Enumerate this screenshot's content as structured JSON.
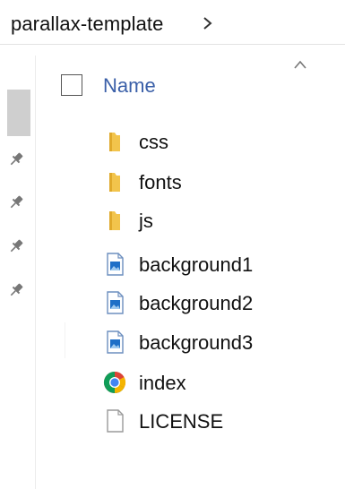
{
  "breadcrumb": {
    "folder": "parallax-template",
    "chevron_icon": "chevron-right-icon"
  },
  "header": {
    "name_label": "Name",
    "sort_icon": "sort-up-icon"
  },
  "files": [
    {
      "name": "css",
      "icon": "folder-icon"
    },
    {
      "name": "fonts",
      "icon": "folder-icon"
    },
    {
      "name": "js",
      "icon": "folder-icon"
    },
    {
      "name": "background1",
      "icon": "image-file-icon"
    },
    {
      "name": "background2",
      "icon": "image-file-icon"
    },
    {
      "name": "background3",
      "icon": "image-file-icon"
    },
    {
      "name": "index",
      "icon": "chrome-icon"
    },
    {
      "name": "LICENSE",
      "icon": "blank-file-icon"
    }
  ],
  "colors": {
    "accent": "#3a5fa8",
    "folder": "#f2c44c",
    "text": "#111111"
  }
}
